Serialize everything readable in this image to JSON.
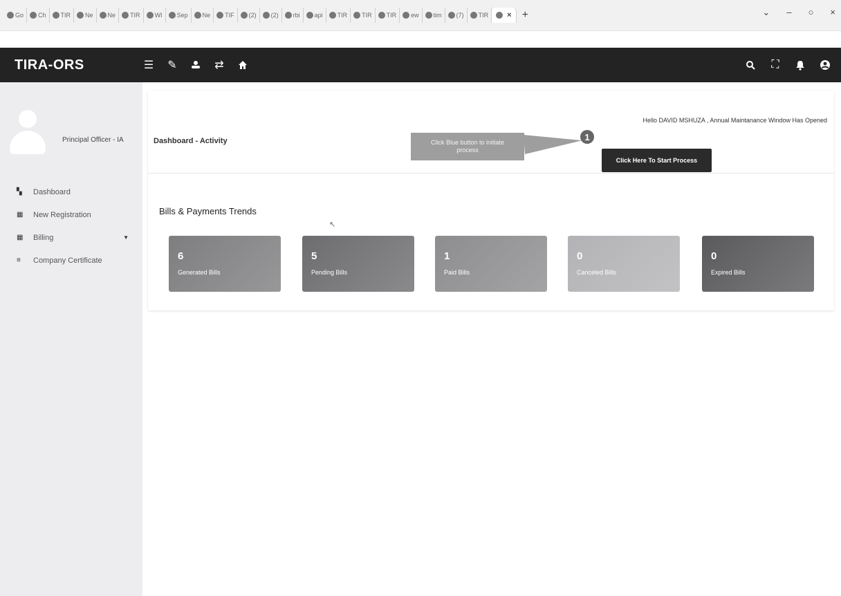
{
  "browser": {
    "tabs": [
      {
        "label": "Go"
      },
      {
        "label": "Ch"
      },
      {
        "label": "TIR"
      },
      {
        "label": "Ne"
      },
      {
        "label": "Ne"
      },
      {
        "label": "TIR"
      },
      {
        "label": "WI"
      },
      {
        "label": "Sep"
      },
      {
        "label": "Ne"
      },
      {
        "label": "TIF"
      },
      {
        "label": "(2)"
      },
      {
        "label": "(2)"
      },
      {
        "label": "rbi"
      },
      {
        "label": "api"
      },
      {
        "label": "TIR"
      },
      {
        "label": "TIR"
      },
      {
        "label": "TIR"
      },
      {
        "label": "ew"
      },
      {
        "label": "tim"
      },
      {
        "label": "(7)"
      },
      {
        "label": "TIR"
      }
    ],
    "active_tab_close": "×",
    "new_tab": "+",
    "controls": {
      "chevron": "⌄",
      "minimize": "–",
      "maximize": "○",
      "close": "×"
    }
  },
  "app": {
    "brand": "TIRA-ORS",
    "toolbar_icons": [
      "menu-icon",
      "pin-icon",
      "user-icon",
      "swap-icon",
      "home-icon"
    ],
    "right_icons": [
      "search-icon",
      "fullscreen-icon",
      "bell-icon",
      "account-icon"
    ]
  },
  "sidebar": {
    "role": "Principal Officer - IA",
    "items": [
      {
        "label": "Dashboard",
        "icon": "dashboard-icon"
      },
      {
        "label": "New Registration",
        "icon": "grid-icon"
      },
      {
        "label": "Billing",
        "icon": "grid-icon",
        "has_caret": true
      },
      {
        "label": "Company Certificate",
        "icon": "list-icon"
      }
    ]
  },
  "main": {
    "page_title": "Dashboard - Activity",
    "greeting": "Hello DAVID MSHUZA , Annual Maintanance Window Has Opened",
    "tooltip": "Click Blue button to initiate process",
    "step_number": "1",
    "start_button": "Click Here To Start Process",
    "section_title": "Bills & Payments Trends",
    "stats": [
      {
        "value": "6",
        "label": "Generated Bills",
        "color": "#7e7e80"
      },
      {
        "value": "5",
        "label": "Pending Bills",
        "color": "#6d6d70"
      },
      {
        "value": "1",
        "label": "Paid Bills",
        "color": "#8d8d8f"
      },
      {
        "value": "0",
        "label": "Canceled Bills",
        "color": "#b3b3b6"
      },
      {
        "value": "0",
        "label": "Expired Bills",
        "color": "#5a5a5d"
      }
    ]
  }
}
